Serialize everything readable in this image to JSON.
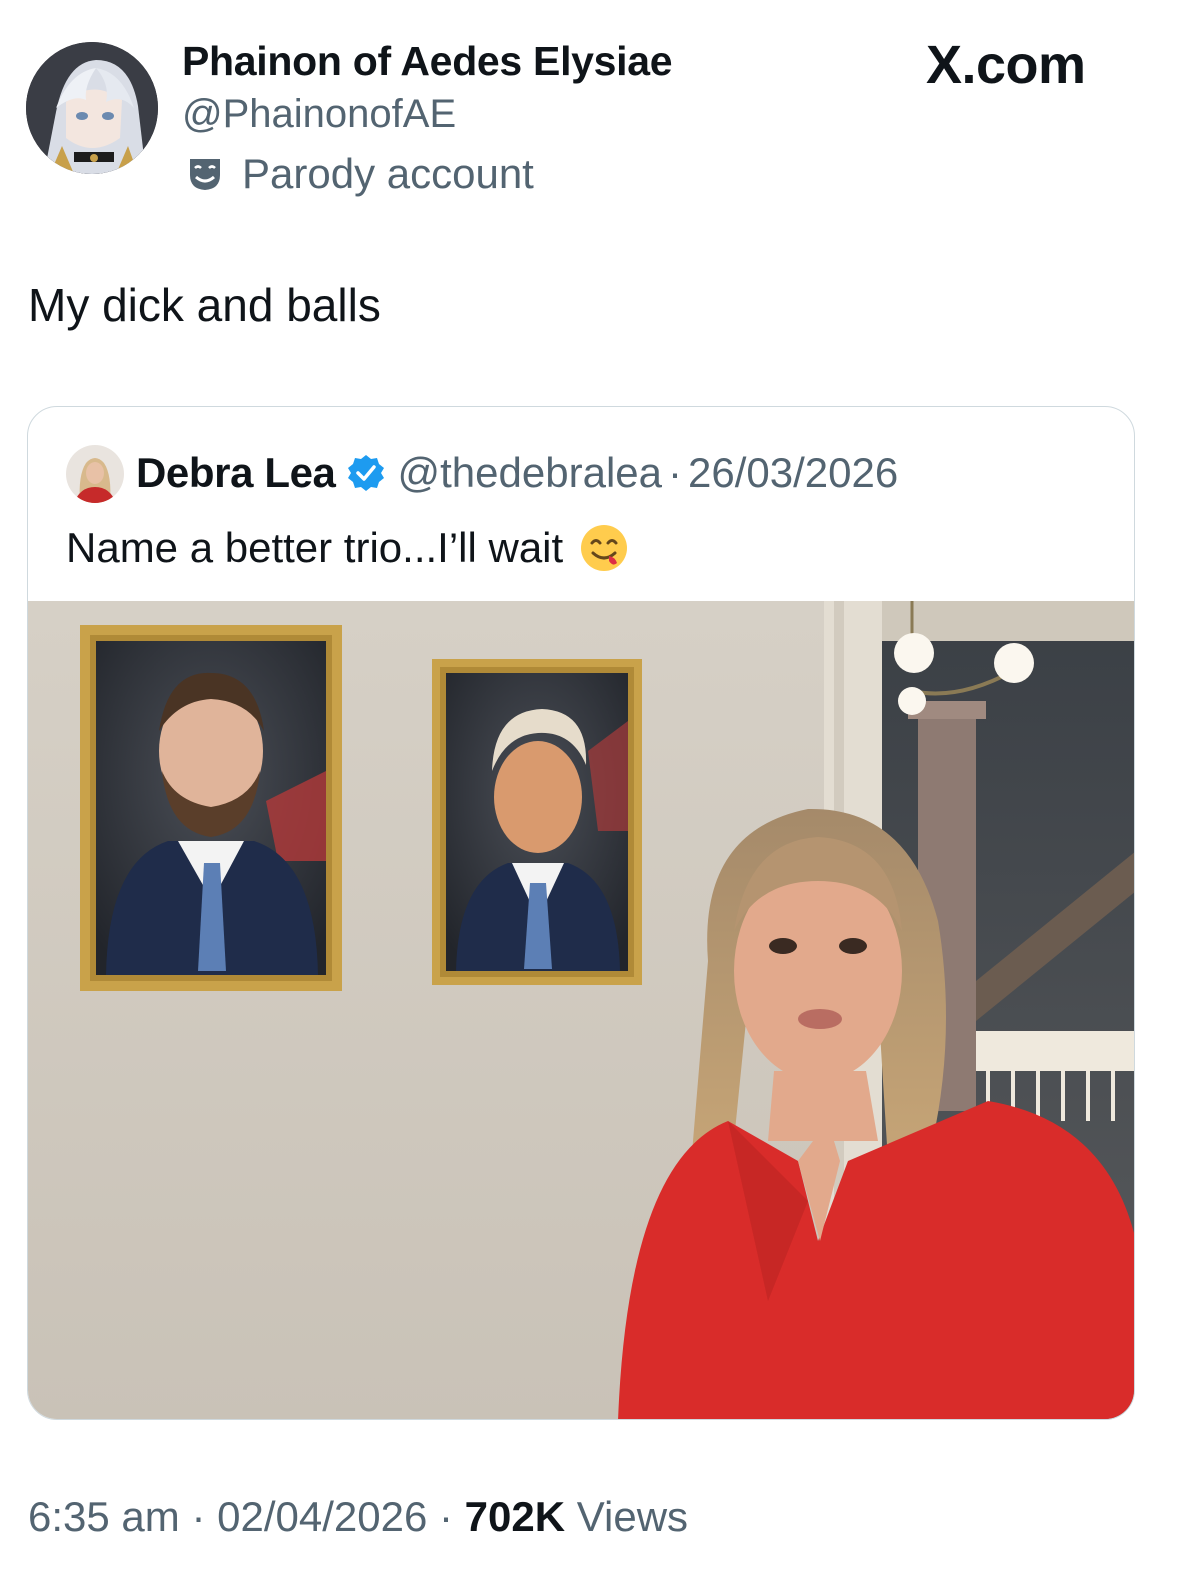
{
  "brand": {
    "label": "X.com"
  },
  "author": {
    "display_name": "Phainon of Aedes Elysiae",
    "handle": "@PhainonofAE",
    "badge_label": "Parody account"
  },
  "tweet": {
    "text": "My dick and balls",
    "time": "6:35 am",
    "date": "02/04/2026",
    "views_count": "702K",
    "views_label": "Views",
    "separator": "·"
  },
  "quote": {
    "display_name": "Debra Lea",
    "handle": "@thedebralea",
    "date": "26/03/2026",
    "separator": "·",
    "text": "Name a better trio...I’ll wait",
    "emoji": "face-savoring-food-emoji",
    "verified_color": "#1d9bf0"
  },
  "colors": {
    "text_primary": "#0f1419",
    "text_secondary": "#536471",
    "border": "#cfd9de",
    "dress_red": "#d92c2a"
  }
}
